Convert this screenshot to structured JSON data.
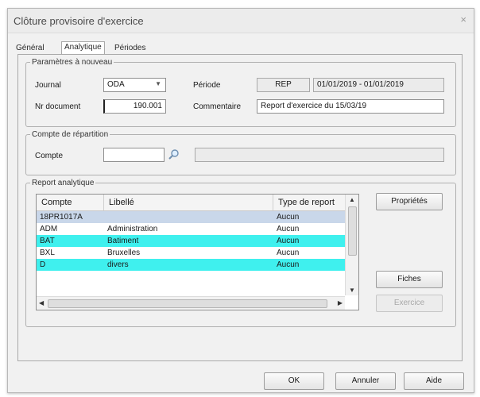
{
  "window": {
    "title": "Clôture provisoire d'exercice",
    "close_glyph": "×"
  },
  "tabs": [
    {
      "label": "Général",
      "active": false
    },
    {
      "label": "Analytique",
      "active": true
    },
    {
      "label": "Périodes",
      "active": false
    }
  ],
  "params": {
    "legend": "Paramètres à nouveau",
    "journal_label": "Journal",
    "journal_value": "ODA",
    "periode_label": "Période",
    "periode_code": "REP",
    "periode_dates": "01/01/2019 - 01/01/2019",
    "nrdoc_label": "Nr document",
    "nrdoc_value": "190.001",
    "comment_label": "Commentaire",
    "comment_value": "Report d'exercice du 15/03/19"
  },
  "compte_rep": {
    "legend": "Compte de répartition",
    "compte_label": "Compte",
    "compte_value": "",
    "compte_desc": "",
    "search_icon": "magnifier-icon"
  },
  "report": {
    "legend": "Report analytique",
    "columns": [
      "Compte",
      "Libellé",
      "Type de report"
    ],
    "rows": [
      {
        "compte": "18PR1017A",
        "libelle": "",
        "type": "Aucun",
        "bg": "#c9d7ea"
      },
      {
        "compte": "ADM",
        "libelle": "Administration",
        "type": "Aucun",
        "bg": "#ffffff"
      },
      {
        "compte": "BAT",
        "libelle": "Batiment",
        "type": "Aucun",
        "bg": "#3ff0ee"
      },
      {
        "compte": "BXL",
        "libelle": "Bruxelles",
        "type": "Aucun",
        "bg": "#ffffff"
      },
      {
        "compte": "D",
        "libelle": "divers",
        "type": "Aucun",
        "bg": "#3ff0ee"
      }
    ]
  },
  "side_buttons": {
    "proprietes": "Propriétés",
    "fiches": "Fiches",
    "exercice": "Exercice"
  },
  "footer_buttons": {
    "ok": "OK",
    "annuler": "Annuler",
    "aide": "Aide"
  },
  "colors": {
    "highlight_cyan": "#3ff0ee",
    "selected_row": "#c9d7ea"
  }
}
